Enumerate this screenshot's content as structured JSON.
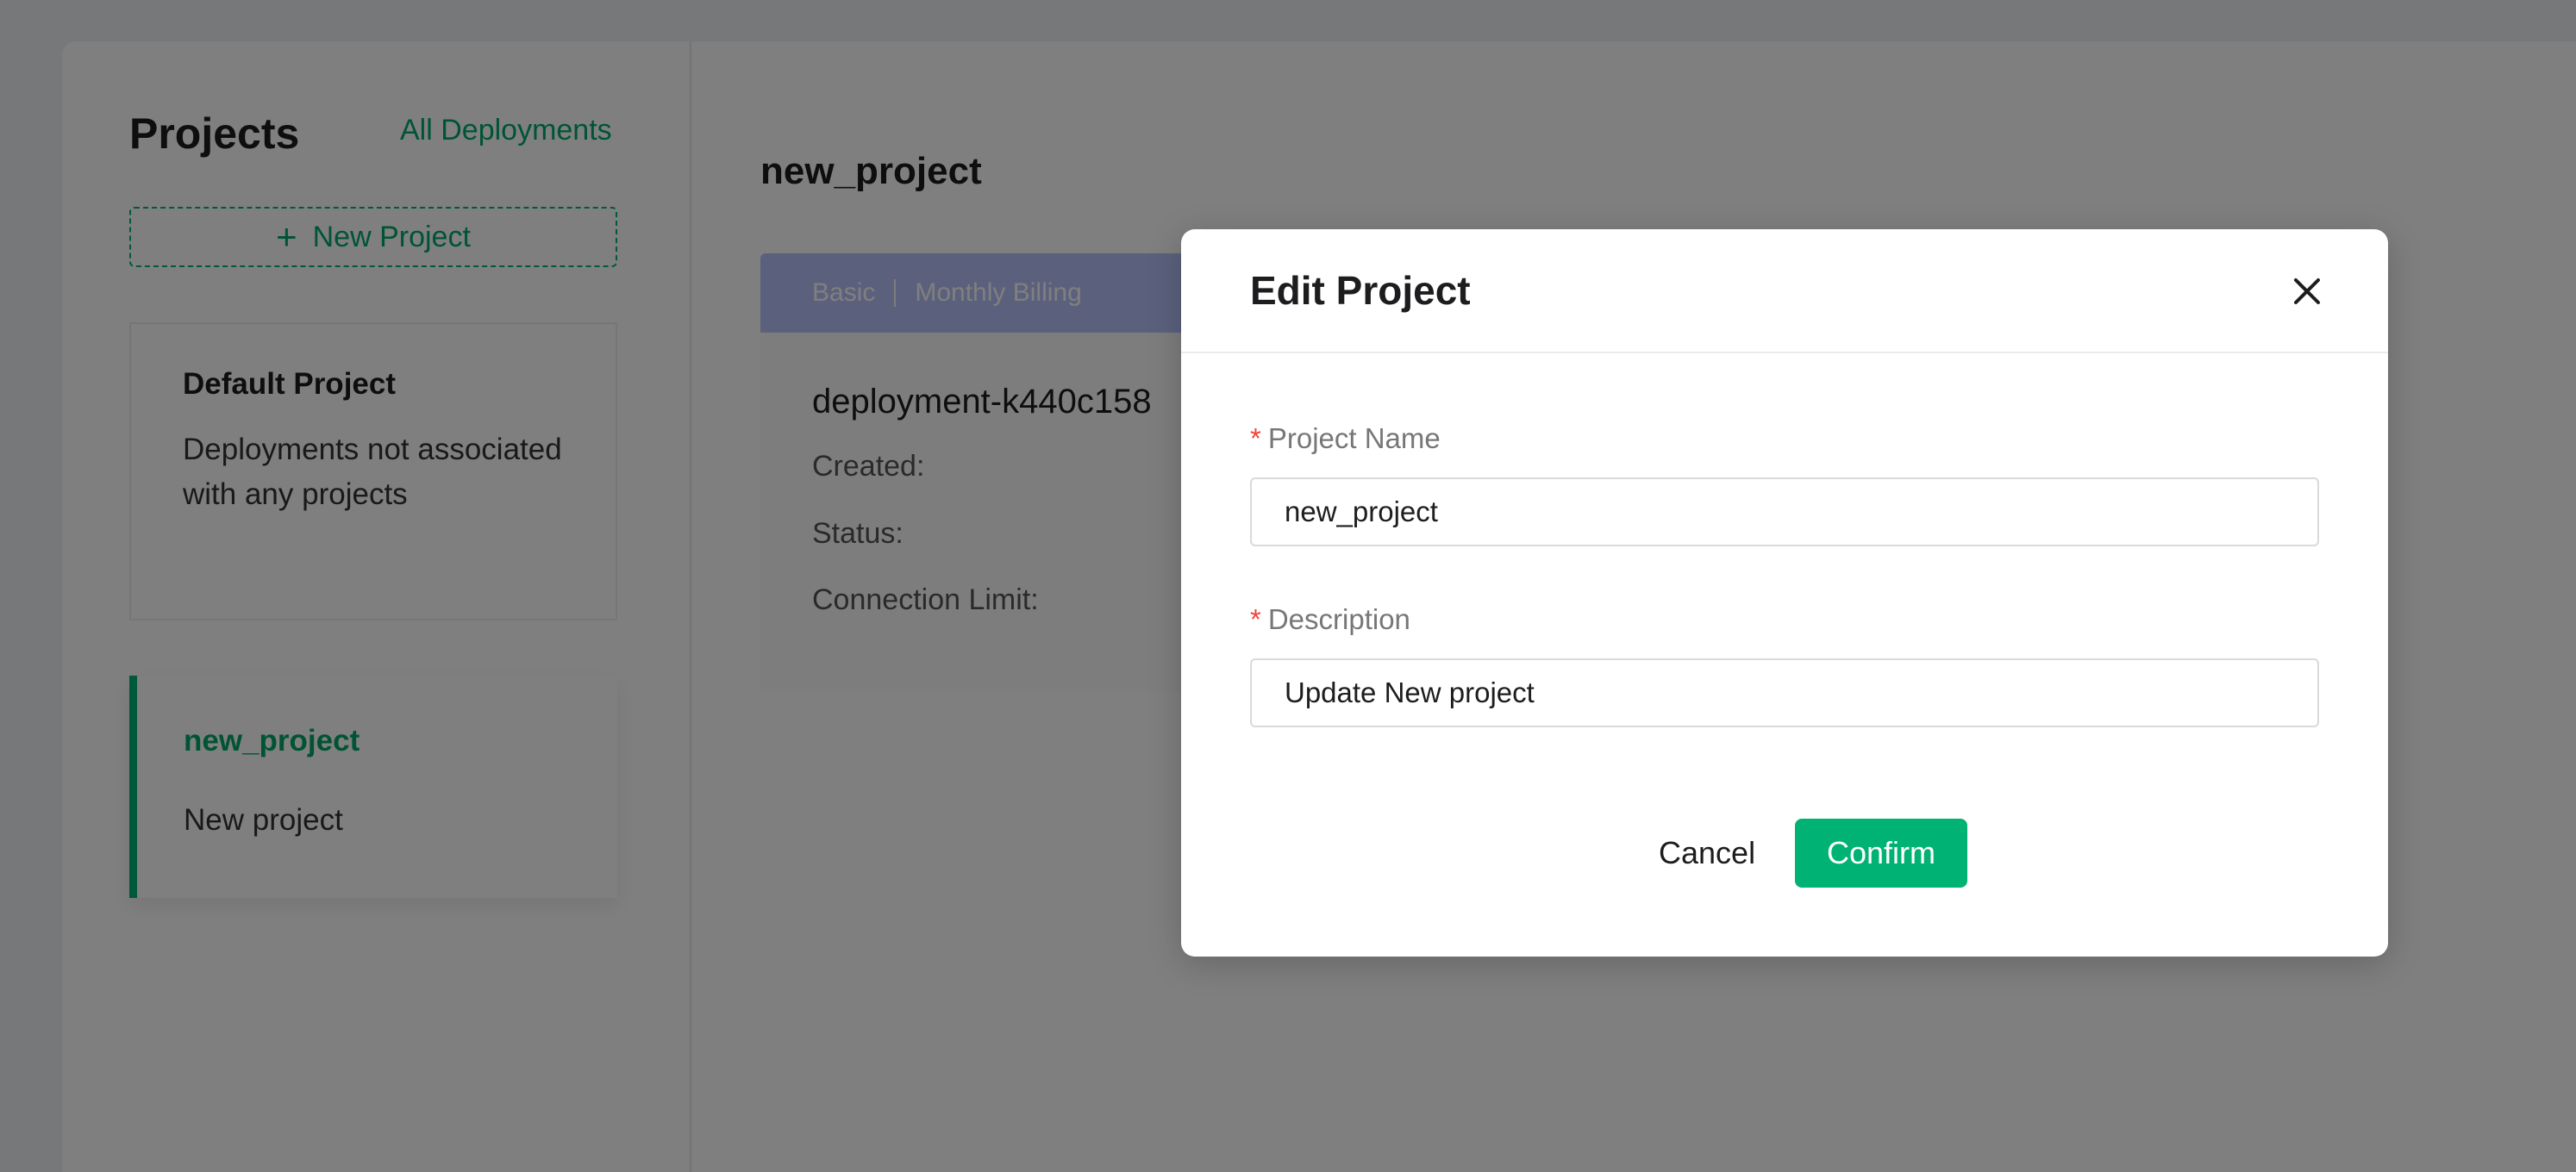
{
  "sidebar": {
    "title": "Projects",
    "all_deployments_link": "All Deployments",
    "new_project_label": "New Project",
    "projects": [
      {
        "name": "Default Project",
        "description": "Deployments not associated with any projects"
      },
      {
        "name": "new_project",
        "description": "New project"
      }
    ]
  },
  "main": {
    "title": "new_project",
    "deployment": {
      "plan": "Basic",
      "billing": "Monthly Billing",
      "name": "deployment-k440c158",
      "fields": [
        "Created:",
        "Status:",
        "Connection Limit:"
      ]
    }
  },
  "modal": {
    "title": "Edit Project",
    "required_marker": "*",
    "project_name_label": "Project Name",
    "project_name_value": "new_project",
    "description_label": "Description",
    "description_value": "Update New project",
    "cancel_label": "Cancel",
    "confirm_label": "Confirm"
  },
  "colors": {
    "accent": "#00b374",
    "header_band": "#b7c3fb",
    "required": "#f04438",
    "overlay": "rgba(0,0,0,0.5)"
  },
  "icons": {
    "plus": "plus-icon",
    "close": "close-icon"
  }
}
